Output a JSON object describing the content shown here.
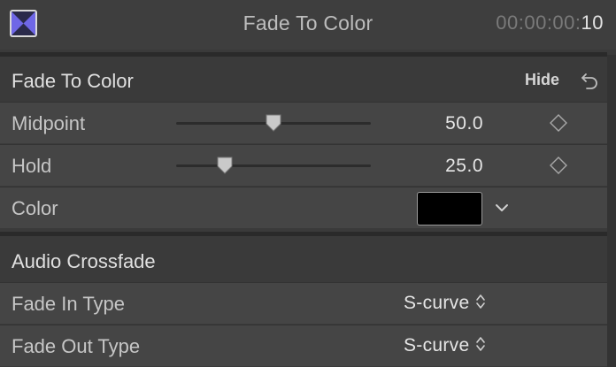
{
  "header": {
    "title": "Fade To Color",
    "timecode_dim": "00:00:00:",
    "timecode_frames": "10",
    "icon": "transition-bowtie-icon",
    "icon_color": "#6f67e6"
  },
  "sections": {
    "fade_to_color": {
      "title": "Fade To Color",
      "hide_label": "Hide",
      "reset_icon": "undo-arrow-icon",
      "params": {
        "midpoint": {
          "label": "Midpoint",
          "value": "50.0",
          "slider_fraction": 0.5
        },
        "hold": {
          "label": "Hold",
          "value": "25.0",
          "slider_fraction": 0.25
        },
        "color": {
          "label": "Color",
          "swatch": "#000000"
        }
      }
    },
    "audio_crossfade": {
      "title": "Audio Crossfade",
      "params": {
        "fade_in": {
          "label": "Fade In Type",
          "value": "S-curve"
        },
        "fade_out": {
          "label": "Fade Out Type",
          "value": "S-curve"
        }
      }
    }
  }
}
